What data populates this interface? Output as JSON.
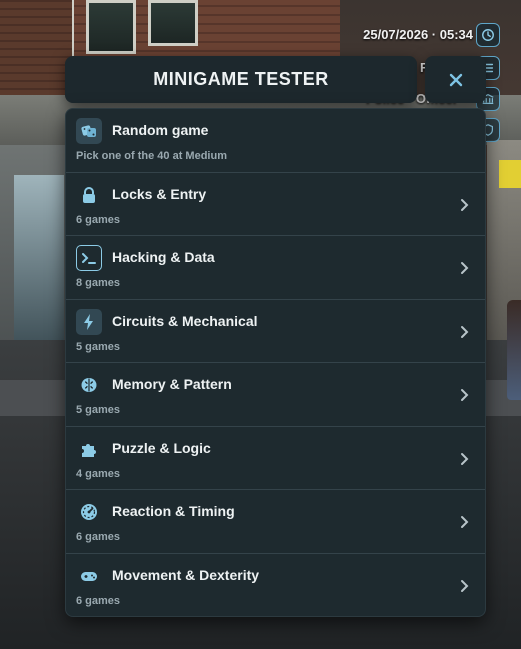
{
  "hud": {
    "datetime": "25/07/2026 · 05:34",
    "partial_text_1": "F",
    "partial_text_2": "Police · Officer"
  },
  "panel": {
    "title": "MINIGAME TESTER",
    "close_icon": "close-icon"
  },
  "items": [
    {
      "icon": "dice-icon",
      "title": "Random game",
      "subtitle": "Pick one of the 40 at Medium",
      "chevron": false
    },
    {
      "icon": "lock-icon",
      "title": "Locks & Entry",
      "subtitle": "6 games",
      "chevron": true
    },
    {
      "icon": "terminal-icon",
      "title": "Hacking & Data",
      "subtitle": "8 games",
      "chevron": true
    },
    {
      "icon": "bolt-icon",
      "title": "Circuits & Mechanical",
      "subtitle": "5 games",
      "chevron": true
    },
    {
      "icon": "brain-icon",
      "title": "Memory & Pattern",
      "subtitle": "5 games",
      "chevron": true
    },
    {
      "icon": "puzzle-icon",
      "title": "Puzzle & Logic",
      "subtitle": "4 games",
      "chevron": true
    },
    {
      "icon": "gauge-icon",
      "title": "Reaction & Timing",
      "subtitle": "6 games",
      "chevron": true
    },
    {
      "icon": "gamepad-icon",
      "title": "Movement & Dexterity",
      "subtitle": "6 games",
      "chevron": true
    }
  ],
  "colors": {
    "accent": "#5fa6c9",
    "panel_bg": "#1e2a2f",
    "text": "#eef2f3",
    "subtext": "#9aa9b0"
  }
}
